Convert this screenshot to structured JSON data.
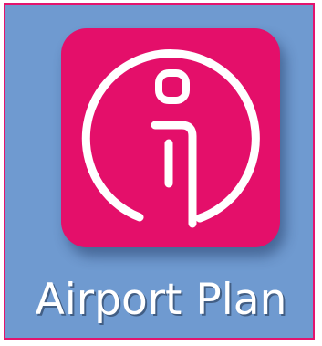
{
  "app": {
    "name": "Airport Plan",
    "icon": "info-person-icon"
  },
  "colors": {
    "icon_background": "#e40f6a",
    "tile_background": "#6f9ad0",
    "tile_border": "#e3146e",
    "glyph": "#ffffff",
    "label": "#ffffff"
  }
}
